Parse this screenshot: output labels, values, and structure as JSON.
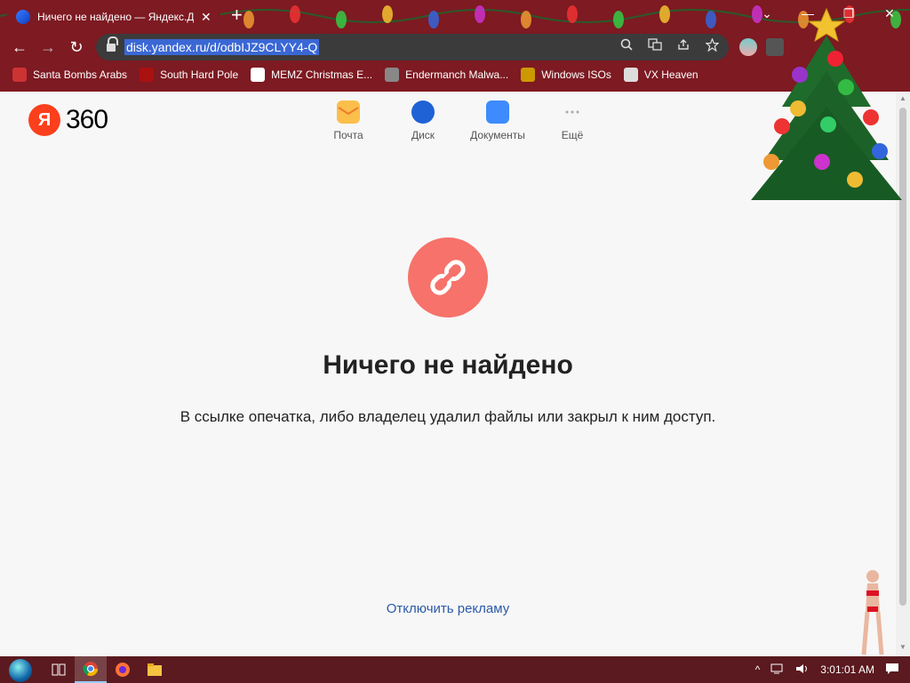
{
  "browser": {
    "tab": {
      "title": "Ничего не найдено — Яндекс.Д",
      "close_label": "✕"
    },
    "new_tab_label": "+",
    "window_buttons": {
      "tablist": "⌄",
      "minimize": "—",
      "maximize": "❐",
      "close": "✕"
    },
    "url": "disk.yandex.ru/d/odbIJZ9CLYY4-Q",
    "nav": {
      "back": "←",
      "forward": "→",
      "reload": "↻"
    },
    "omnibox_icons": [
      "search-icon",
      "translate-icon",
      "share-icon",
      "bookmark-star-icon"
    ],
    "menu_label": "⋮",
    "bookmarks": [
      {
        "label": "Santa Bombs Arabs",
        "icon": "santa-icon"
      },
      {
        "label": "South Hard Pole",
        "icon": "snowflake-icon"
      },
      {
        "label": "MEMZ Christmas E...",
        "icon": "memz-icon"
      },
      {
        "label": "Endermanch Malwa...",
        "icon": "endermanch-icon"
      },
      {
        "label": "Windows ISOs",
        "icon": "windows-isos-icon"
      },
      {
        "label": "VX Heaven",
        "icon": "vx-heaven-icon"
      }
    ]
  },
  "page": {
    "logo": {
      "ya": "Я",
      "text": "360"
    },
    "services": [
      {
        "label": "Почта",
        "color": "#f5a623"
      },
      {
        "label": "Диск",
        "color": "#1f62d6"
      },
      {
        "label": "Документы",
        "color": "#3d8bfd"
      },
      {
        "label": "Ещё",
        "color": "#aaaaaa"
      }
    ],
    "error": {
      "title": "Ничего не найдено",
      "description": "В ссылке опечатка, либо владелец удалил файлы или закрыл к ним доступ."
    },
    "disable_ads_link": "Отключить рекламу"
  },
  "taskbar": {
    "apps": [
      "task-view-icon",
      "chrome-icon",
      "firefox-icon",
      "file-explorer-icon"
    ],
    "clock": "3:01:01 AM",
    "tray_chevron": "^"
  },
  "colors": {
    "chrome_bg": "#7d1a22",
    "accent_red": "#f6726a",
    "link_blue": "#2c5aa8"
  }
}
